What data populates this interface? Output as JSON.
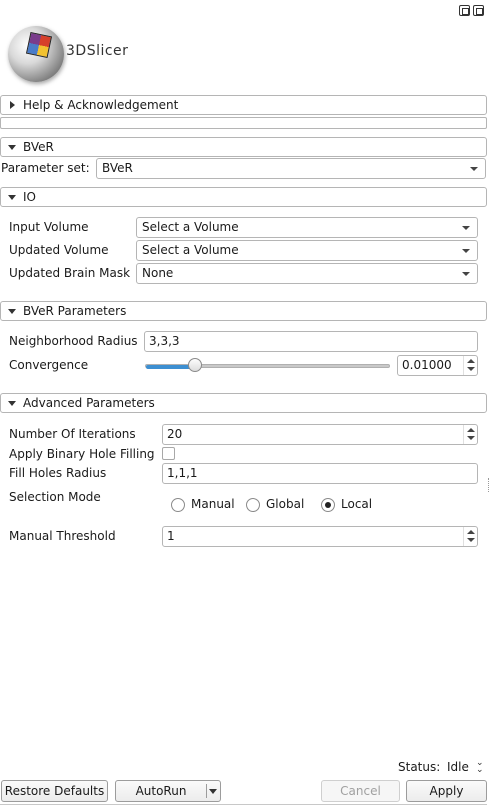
{
  "logo": {
    "text": "3DSlicer"
  },
  "help_section": {
    "title": "Help & Acknowledgement",
    "expanded": false
  },
  "module_section": {
    "title": "BVeR",
    "expanded": true
  },
  "parameter_set": {
    "label": "Parameter set:",
    "value": "BVeR"
  },
  "io_section": {
    "title": "IO",
    "expanded": true,
    "input_volume": {
      "label": "Input Volume",
      "value": "Select a Volume"
    },
    "updated_volume": {
      "label": "Updated Volume",
      "value": "Select a Volume"
    },
    "updated_brain_mask": {
      "label": "Updated Brain Mask",
      "value": "None"
    }
  },
  "params_section": {
    "title": "BVeR Parameters",
    "expanded": true,
    "neighborhood_radius": {
      "label": "Neighborhood Radius",
      "value": "3,3,3"
    },
    "convergence": {
      "label": "Convergence",
      "value": "0.01000",
      "slider_fraction": 0.2
    }
  },
  "advanced_section": {
    "title": "Advanced Parameters",
    "expanded": true,
    "iterations": {
      "label": "Number Of Iterations",
      "value": "20"
    },
    "hole_filling": {
      "label": "Apply Binary Hole Filling",
      "checked": false
    },
    "fill_holes_radius": {
      "label": "Fill Holes Radius",
      "value": "1,1,1"
    },
    "selection_mode": {
      "label": "Selection Mode",
      "options": [
        "Manual",
        "Global",
        "Local"
      ],
      "selected": "Local"
    },
    "manual_threshold": {
      "label": "Manual Threshold",
      "value": "1"
    }
  },
  "status": {
    "label": "Status:",
    "value": "Idle"
  },
  "buttons": {
    "restore_defaults": "Restore Defaults",
    "autorun": "AutoRun",
    "cancel": "Cancel",
    "apply": "Apply"
  },
  "colors": {
    "slider_accent": "#3d8fd1"
  }
}
